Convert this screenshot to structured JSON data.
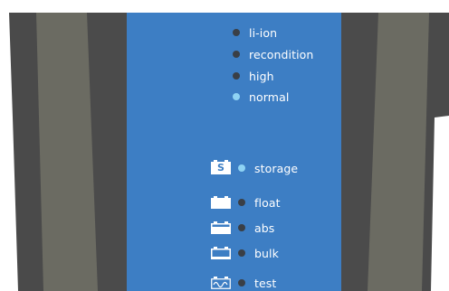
{
  "colors": {
    "panel": "#3d7ec4",
    "led_off": "#3a3f46",
    "led_on": "#8fd3f4",
    "casing_dark": "#4b4b4b",
    "casing_olive": "#6c6c63",
    "label": "#ffffff"
  },
  "modes": [
    {
      "label": "li-ion",
      "state": "off"
    },
    {
      "label": "recondition",
      "state": "off"
    },
    {
      "label": "high",
      "state": "off"
    },
    {
      "label": "normal",
      "state": "on"
    }
  ],
  "stages": [
    {
      "label": "storage",
      "icon": "storage-s-icon",
      "icon_text": "S",
      "state": "on"
    },
    {
      "label": "float",
      "icon": "battery-full-icon",
      "state": "off"
    },
    {
      "label": "abs",
      "icon": "battery-high-icon",
      "state": "off"
    },
    {
      "label": "bulk",
      "icon": "battery-empty-icon",
      "state": "off"
    },
    {
      "label": "test",
      "icon": "battery-test-wave-icon",
      "state": "off"
    }
  ]
}
